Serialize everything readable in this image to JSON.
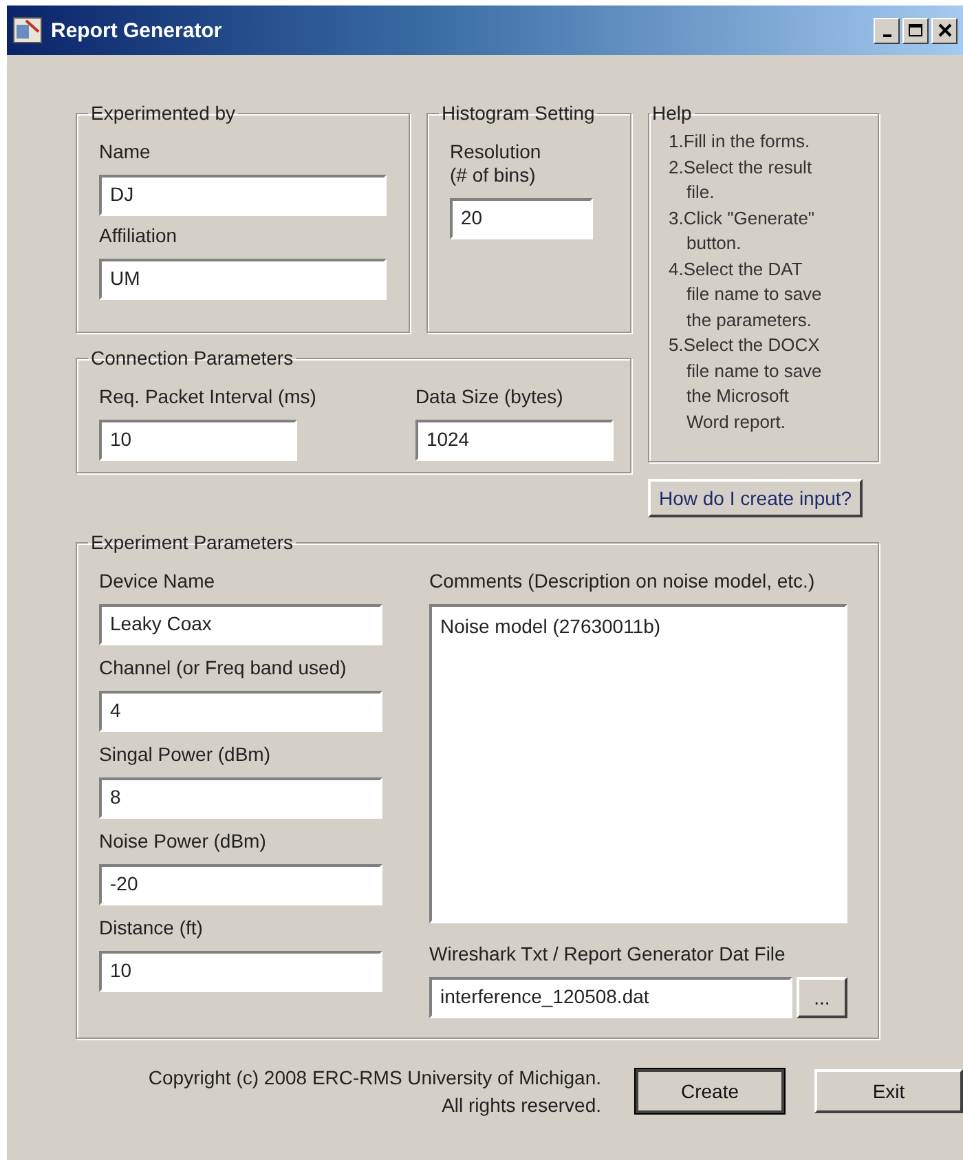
{
  "window": {
    "title": "Report Generator"
  },
  "experimented_by": {
    "title": "Experimented by",
    "fields": [
      {
        "label": "Name",
        "value": "DJ"
      },
      {
        "label": "Affiliation",
        "value": "UM"
      }
    ]
  },
  "histogram_setting": {
    "title": "Histogram Setting",
    "label": "Resolution\n(# of bins)",
    "value": "20"
  },
  "help": {
    "title": "Help",
    "steps": [
      "1.Fill in the forms.",
      "2.Select the result file.",
      "3.Click \"Generate\" button.",
      "4.Select the DAT file name to save the parameters.",
      "5.Select the DOCX file name to save the Microsoft Word report."
    ],
    "button": "How do I create input?"
  },
  "connection_parameters": {
    "title": "Connection Parameters",
    "fields": [
      {
        "label": "Req. Packet Interval (ms)",
        "value": "10"
      },
      {
        "label": "Data Size (bytes)",
        "value": "1024"
      }
    ]
  },
  "experiment_parameters": {
    "title": "Experiment Parameters",
    "fields": [
      {
        "label": "Device Name",
        "value": "Leaky Coax"
      },
      {
        "label": "Channel (or Freq band used)",
        "value": "4"
      },
      {
        "label": "Singal Power (dBm)",
        "value": "8"
      },
      {
        "label": "Noise Power (dBm)",
        "value": "-20"
      },
      {
        "label": "Distance (ft)",
        "value": "10"
      }
    ],
    "comments": {
      "label": "Comments (Description on noise model, etc.)",
      "value": "Noise model (27630011b)"
    },
    "file": {
      "label": "Wireshark Txt / Report Generator Dat File",
      "value": "interference_120508.dat",
      "browse": "..."
    }
  },
  "footer": {
    "copyright": [
      "Copyright (c) 2008 ERC-RMS University of Michigan.",
      "All rights reserved."
    ],
    "buttons": [
      "Create",
      "Exit"
    ]
  }
}
